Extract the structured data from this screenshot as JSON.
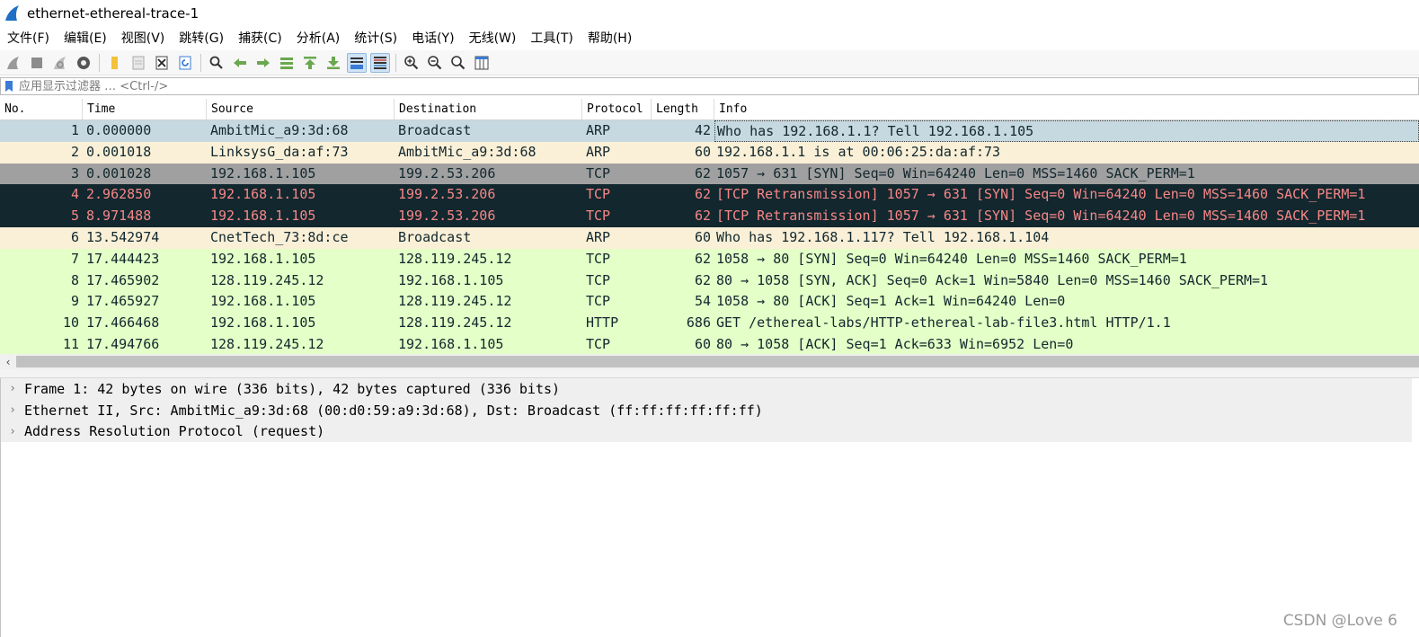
{
  "window": {
    "title": "ethernet-ethereal-trace-1"
  },
  "menu": [
    "文件(F)",
    "编辑(E)",
    "视图(V)",
    "跳转(G)",
    "捕获(C)",
    "分析(A)",
    "统计(S)",
    "电话(Y)",
    "无线(W)",
    "工具(T)",
    "帮助(H)"
  ],
  "toolbar": {
    "icons": [
      "shark-fin-start-icon",
      "stop-square-icon",
      "restart-fin-icon",
      "gear-options-icon",
      "open-folder-icon",
      "save-file-icon",
      "close-file-icon",
      "reload-icon",
      "find-magnifier-icon",
      "go-back-arrow-icon",
      "go-forward-arrow-icon",
      "go-to-packet-icon",
      "go-first-icon",
      "go-last-icon",
      "autoscroll-icon",
      "colorize-icon",
      "zoom-in-icon",
      "zoom-out-icon",
      "zoom-normal-icon",
      "resize-columns-icon"
    ]
  },
  "filter": {
    "placeholder": "应用显示过滤器 … <Ctrl-/>"
  },
  "packet_list": {
    "columns": [
      "No.",
      "Time",
      "Source",
      "Destination",
      "Protocol",
      "Length",
      "Info"
    ],
    "rows": [
      {
        "no": "1",
        "time": "0.000000",
        "source": "AmbitMic_a9:3d:68",
        "destination": "Broadcast",
        "protocol": "ARP",
        "length": "42",
        "info": "Who has 192.168.1.1? Tell 192.168.1.105",
        "bg": "#c6d9e0",
        "fg": "#12272e",
        "selected": true
      },
      {
        "no": "2",
        "time": "0.001018",
        "source": "LinksysG_da:af:73",
        "destination": "AmbitMic_a9:3d:68",
        "protocol": "ARP",
        "length": "60",
        "info": "192.168.1.1 is at 00:06:25:da:af:73",
        "bg": "#faf0d7",
        "fg": "#12272e"
      },
      {
        "no": "3",
        "time": "0.001028",
        "source": "192.168.1.105",
        "destination": "199.2.53.206",
        "protocol": "TCP",
        "length": "62",
        "info": "1057 → 631 [SYN] Seq=0 Win=64240 Len=0 MSS=1460 SACK_PERM=1",
        "bg": "#a0a0a0",
        "fg": "#12272e"
      },
      {
        "no": "4",
        "time": "2.962850",
        "source": "192.168.1.105",
        "destination": "199.2.53.206",
        "protocol": "TCP",
        "length": "62",
        "info": "[TCP Retransmission] 1057 → 631 [SYN] Seq=0 Win=64240 Len=0 MSS=1460 SACK_PERM=1",
        "bg": "#12272e",
        "fg": "#f78787"
      },
      {
        "no": "5",
        "time": "8.971488",
        "source": "192.168.1.105",
        "destination": "199.2.53.206",
        "protocol": "TCP",
        "length": "62",
        "info": "[TCP Retransmission] 1057 → 631 [SYN] Seq=0 Win=64240 Len=0 MSS=1460 SACK_PERM=1",
        "bg": "#12272e",
        "fg": "#f78787"
      },
      {
        "no": "6",
        "time": "13.542974",
        "source": "CnetTech_73:8d:ce",
        "destination": "Broadcast",
        "protocol": "ARP",
        "length": "60",
        "info": "Who has 192.168.1.117? Tell 192.168.1.104",
        "bg": "#faf0d7",
        "fg": "#12272e"
      },
      {
        "no": "7",
        "time": "17.444423",
        "source": "192.168.1.105",
        "destination": "128.119.245.12",
        "protocol": "TCP",
        "length": "62",
        "info": "1058 → 80 [SYN] Seq=0 Win=64240 Len=0 MSS=1460 SACK_PERM=1",
        "bg": "#e4ffc7",
        "fg": "#12272e"
      },
      {
        "no": "8",
        "time": "17.465902",
        "source": "128.119.245.12",
        "destination": "192.168.1.105",
        "protocol": "TCP",
        "length": "62",
        "info": "80 → 1058 [SYN, ACK] Seq=0 Ack=1 Win=5840 Len=0 MSS=1460 SACK_PERM=1",
        "bg": "#e4ffc7",
        "fg": "#12272e"
      },
      {
        "no": "9",
        "time": "17.465927",
        "source": "192.168.1.105",
        "destination": "128.119.245.12",
        "protocol": "TCP",
        "length": "54",
        "info": "1058 → 80 [ACK] Seq=1 Ack=1 Win=64240 Len=0",
        "bg": "#e4ffc7",
        "fg": "#12272e"
      },
      {
        "no": "10",
        "time": "17.466468",
        "source": "192.168.1.105",
        "destination": "128.119.245.12",
        "protocol": "HTTP",
        "length": "686",
        "info": "GET /ethereal-labs/HTTP-ethereal-lab-file3.html HTTP/1.1",
        "bg": "#e4ffc7",
        "fg": "#12272e"
      },
      {
        "no": "11",
        "time": "17.494766",
        "source": "128.119.245.12",
        "destination": "192.168.1.105",
        "protocol": "TCP",
        "length": "60",
        "info": "80 → 1058 [ACK] Seq=1 Ack=633 Win=6952 Len=0",
        "bg": "#e4ffc7",
        "fg": "#12272e"
      }
    ]
  },
  "details": {
    "items": [
      "Frame 1: 42 bytes on wire (336 bits), 42 bytes captured (336 bits)",
      "Ethernet II, Src: AmbitMic_a9:3d:68 (00:d0:59:a9:3d:68), Dst: Broadcast (ff:ff:ff:ff:ff:ff)",
      "Address Resolution Protocol (request)"
    ]
  },
  "watermark": "CSDN @Love 6"
}
